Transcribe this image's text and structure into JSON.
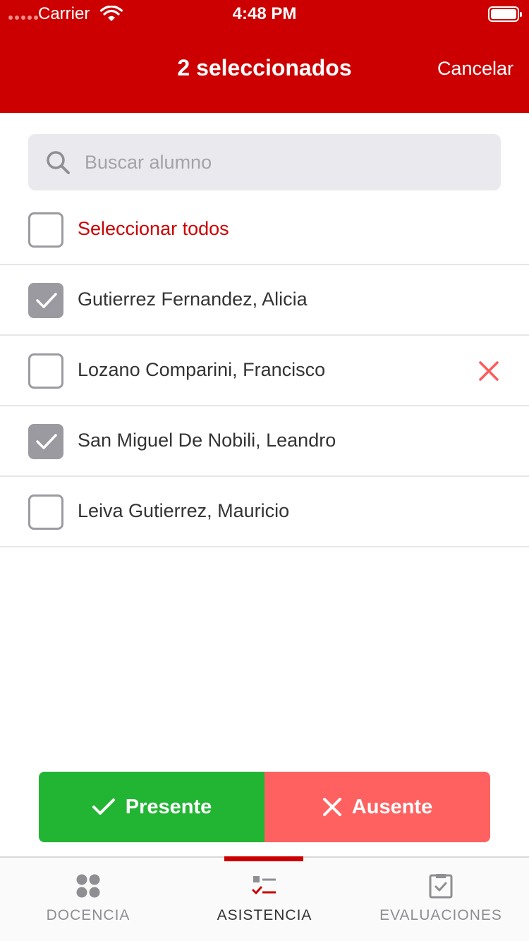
{
  "status_bar": {
    "carrier": "Carrier",
    "time": "4:48 PM"
  },
  "nav": {
    "title": "2 seleccionados",
    "cancel_label": "Cancelar"
  },
  "search": {
    "placeholder": "Buscar alumno"
  },
  "select_all": {
    "label": "Seleccionar todos",
    "checked": false
  },
  "students": [
    {
      "name": "Gutierrez Fernandez, Alicia",
      "checked": true,
      "status": ""
    },
    {
      "name": "Lozano Comparini, Francisco",
      "checked": false,
      "status": "absent"
    },
    {
      "name": "San Miguel De Nobili, Leandro",
      "checked": true,
      "status": ""
    },
    {
      "name": "Leiva Gutierrez, Mauricio",
      "checked": false,
      "status": ""
    }
  ],
  "actions": {
    "present_label": "Presente",
    "absent_label": "Ausente"
  },
  "tabs": [
    {
      "label": "DOCENCIA",
      "icon": "grid-dots-icon",
      "active": false
    },
    {
      "label": "ASISTENCIA",
      "icon": "checklist-icon",
      "active": true
    },
    {
      "label": "EVALUACIONES",
      "icon": "clipboard-check-icon",
      "active": false
    }
  ],
  "colors": {
    "brand": "#cc0000",
    "present": "#22b534",
    "absent": "#ff6161",
    "absent_mark": "#ff5a5a",
    "checked_box": "#9a9aa0"
  }
}
